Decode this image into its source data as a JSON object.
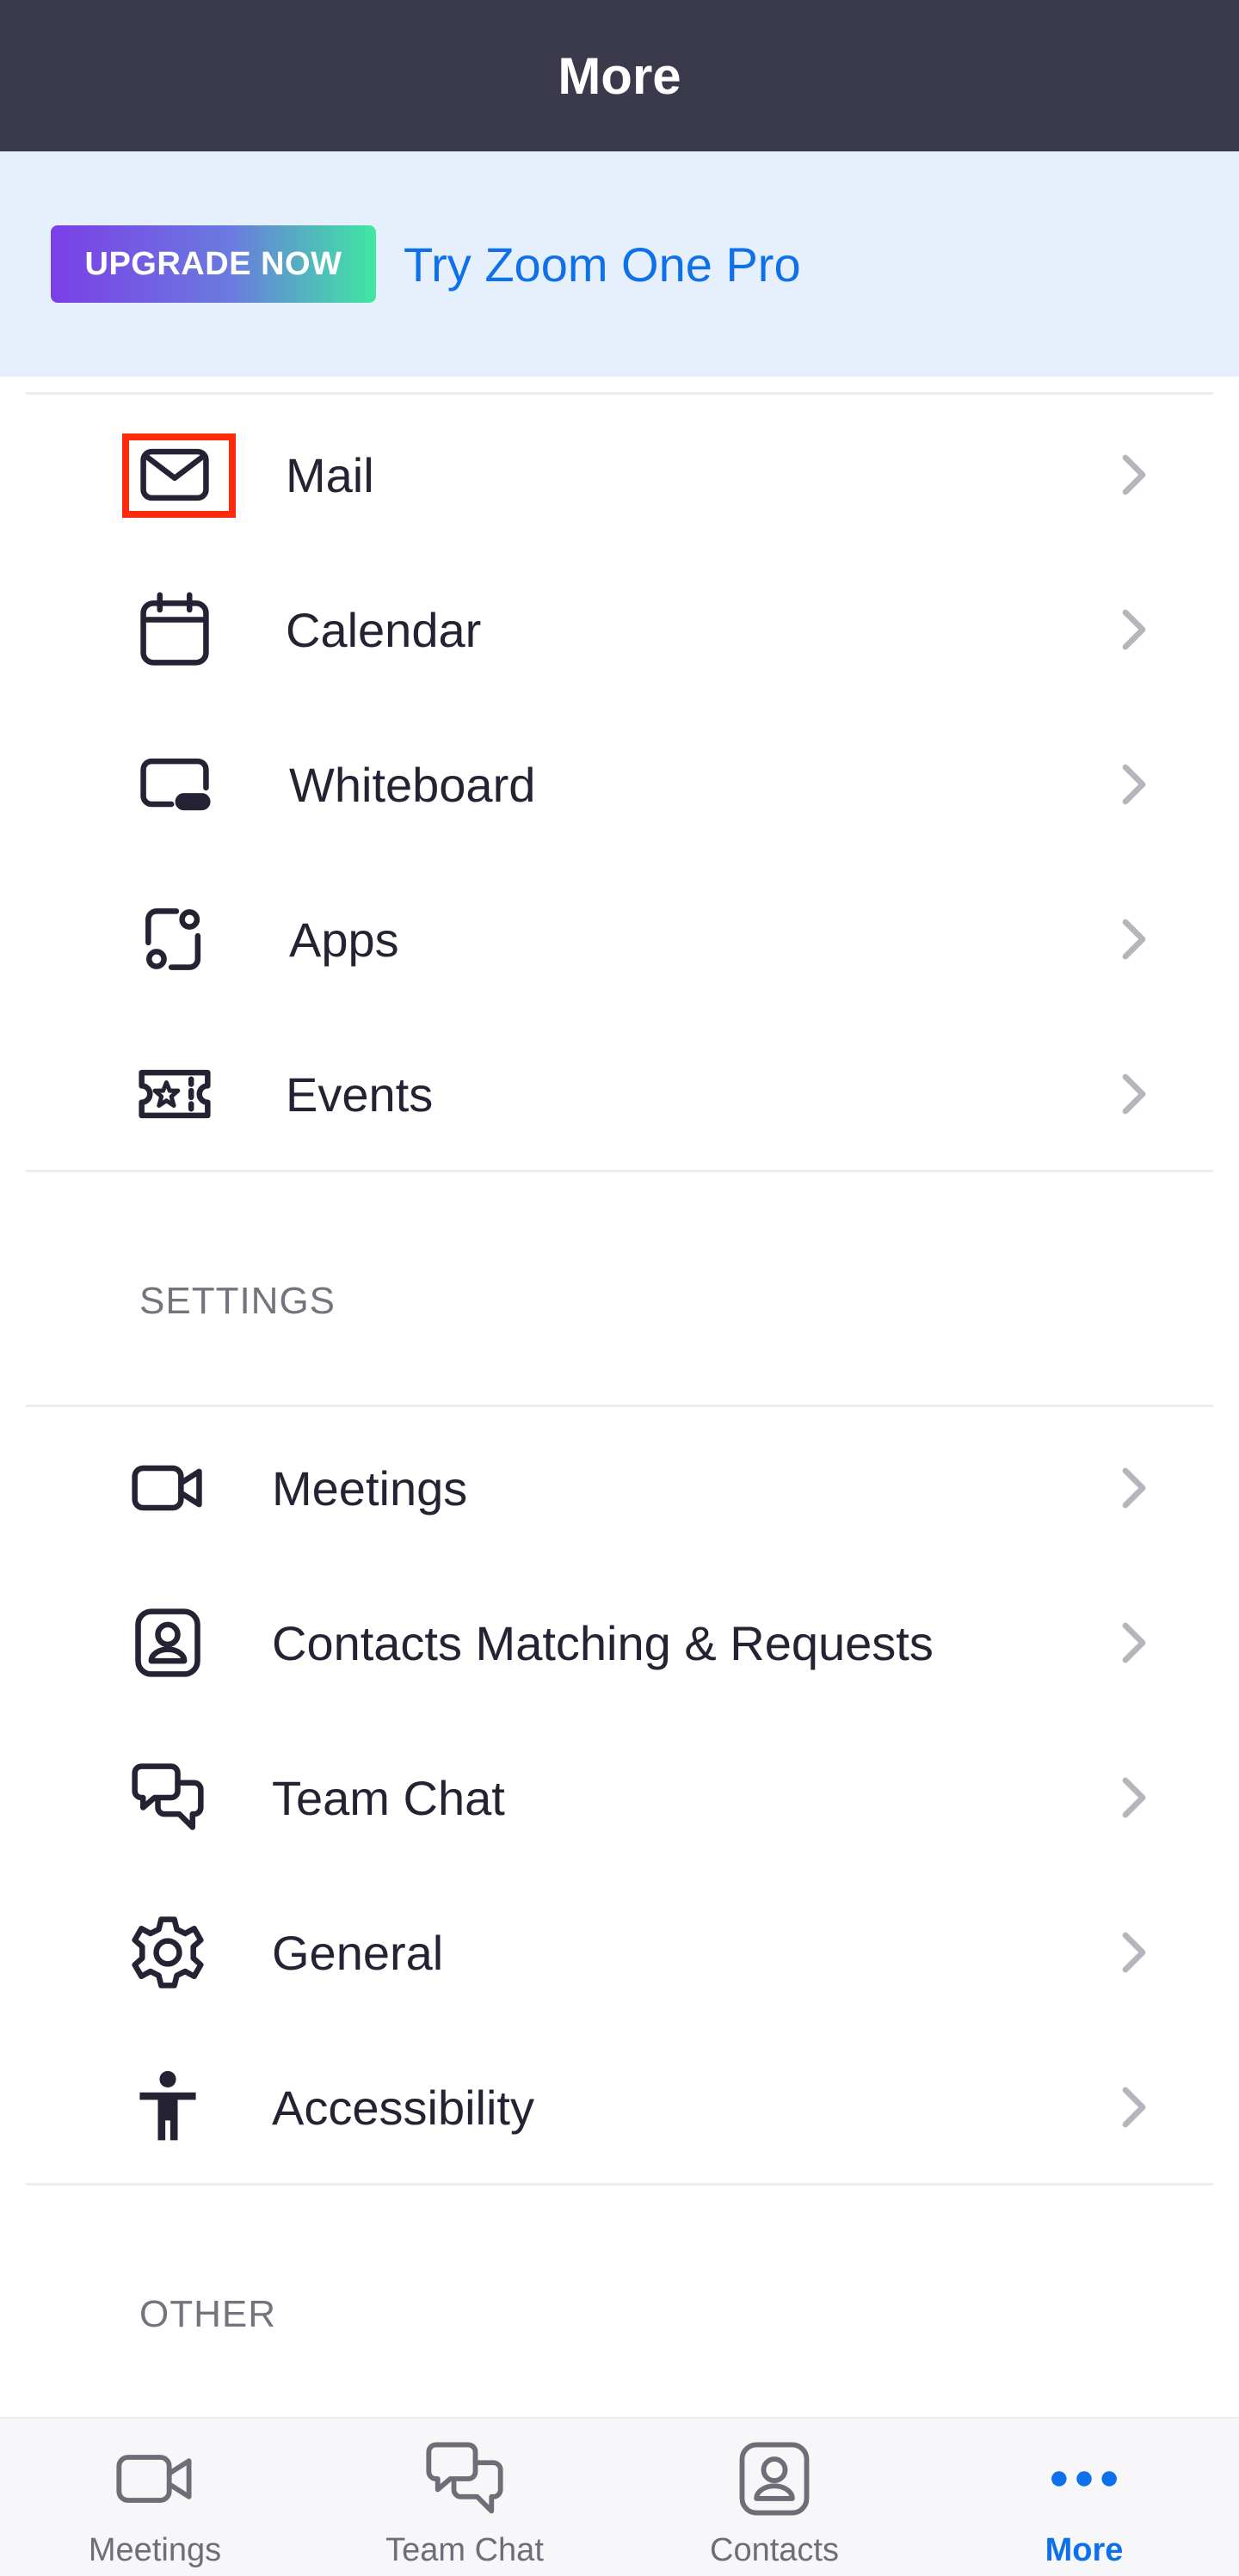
{
  "header": {
    "title": "More"
  },
  "banner": {
    "upgrade_label": "UPGRADE NOW",
    "link_text": "Try Zoom One Pro"
  },
  "menu": {
    "items": [
      {
        "label": "Mail",
        "icon": "mail-icon"
      },
      {
        "label": "Calendar",
        "icon": "calendar-icon"
      },
      {
        "label": "Whiteboard",
        "icon": "whiteboard-icon"
      },
      {
        "label": "Apps",
        "icon": "apps-icon"
      },
      {
        "label": "Events",
        "icon": "events-icon"
      }
    ]
  },
  "settings": {
    "heading": "SETTINGS",
    "items": [
      {
        "label": "Meetings",
        "icon": "video-icon"
      },
      {
        "label": "Contacts Matching & Requests",
        "icon": "contact-card-icon"
      },
      {
        "label": "Team Chat",
        "icon": "chat-bubbles-icon"
      },
      {
        "label": "General",
        "icon": "gear-icon"
      },
      {
        "label": "Accessibility",
        "icon": "accessibility-icon"
      }
    ]
  },
  "other": {
    "heading": "OTHER"
  },
  "tabbar": {
    "tabs": [
      {
        "label": "Meetings",
        "icon": "video-icon",
        "active": false
      },
      {
        "label": "Team Chat",
        "icon": "chat-bubbles-icon",
        "active": false
      },
      {
        "label": "Contacts",
        "icon": "contact-card-icon",
        "active": false
      },
      {
        "label": "More",
        "icon": "more-dots-icon",
        "active": true
      }
    ]
  },
  "colors": {
    "header_bg": "#3a3a4c",
    "banner_bg": "#e5f0fc",
    "accent": "#0e71eb",
    "highlight": "#ff2a0a"
  }
}
